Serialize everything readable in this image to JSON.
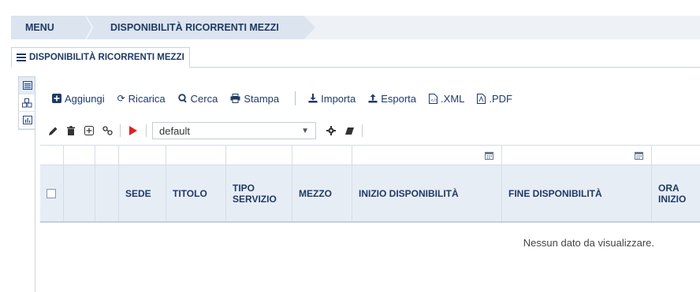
{
  "breadcrumb": [
    "MENU",
    "DISPONIBILITÀ RICORRENTI MEZZI"
  ],
  "tab": {
    "label": "DISPONIBILITÀ RICORRENTI MEZZI",
    "icon": "list-icon"
  },
  "side_tools": [
    {
      "icon": "list-icon",
      "active": true
    },
    {
      "icon": "cubes-icon",
      "active": false
    },
    {
      "icon": "bar-chart-icon",
      "active": false
    }
  ],
  "toolbar": {
    "add": "Aggiungi",
    "reload": "Ricarica",
    "search": "Cerca",
    "print": "Stampa",
    "import": "Importa",
    "export": "Esporta",
    "xml": ".XML",
    "pdf": ".PDF"
  },
  "toolbar2": {
    "layout_select_value": "default",
    "icons": [
      "pencil-icon",
      "trash-icon",
      "expand-icon",
      "link-icon",
      "play-icon",
      "gear-icon",
      "eraser-icon"
    ]
  },
  "grid": {
    "columns": [
      "",
      "",
      "",
      "SEDE",
      "TITOLO",
      "TIPO SERVIZIO",
      "MEZZO",
      "INIZIO DISPONIBILITÀ",
      "FINE DISPONIBILITÀ",
      "ORA INIZIO"
    ],
    "rows": [],
    "empty_message": "Nessun dato da visualizzare."
  },
  "colors": {
    "accent": "#1f3a66",
    "header_bg": "#e7edf5",
    "play_red": "#e02020"
  }
}
